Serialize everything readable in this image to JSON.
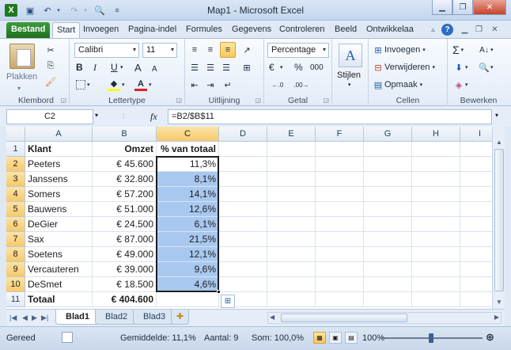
{
  "window": {
    "title": "Map1 - Microsoft Excel"
  },
  "ribbon_tabs": [
    "Bestand",
    "Start",
    "Invoegen",
    "Pagina-indel",
    "Formules",
    "Gegevens",
    "Controleren",
    "Beeld",
    "Ontwikkelaa"
  ],
  "ribbon": {
    "clipboard": {
      "paste_label": "Plakken",
      "group_label": "Klembord"
    },
    "font": {
      "font_name": "Calibri",
      "font_size": "11",
      "bold": "B",
      "italic": "I",
      "underline": "U",
      "grow": "A",
      "shrink": "A",
      "group_label": "Lettertype"
    },
    "alignment": {
      "group_label": "Uitlijning"
    },
    "number": {
      "format": "Percentage",
      "currency_symbol": "€",
      "percent": "%",
      "thousands": "000",
      "group_label": "Getal"
    },
    "styles": {
      "label": "Stijlen",
      "icon_letter": "A"
    },
    "cells": {
      "insert": "Invoegen",
      "delete": "Verwijderen",
      "format": "Opmaak",
      "group_label": "Cellen"
    },
    "editing": {
      "sum_symbol": "Σ",
      "group_label": "Bewerken"
    }
  },
  "formula_bar": {
    "name_box": "C2",
    "fx": "fx",
    "formula": "=B2/$B$11"
  },
  "sheet": {
    "columns": [
      "A",
      "B",
      "C",
      "D",
      "E",
      "F",
      "G",
      "H",
      "I"
    ],
    "rows": [
      {
        "num": "1",
        "a": "Klant",
        "b": "Omzet",
        "c": "% van totaal"
      },
      {
        "num": "2",
        "a": "Peeters",
        "b": "€ 45.600",
        "c": "11,3%"
      },
      {
        "num": "3",
        "a": "Janssens",
        "b": "€ 32.800",
        "c": "8,1%"
      },
      {
        "num": "4",
        "a": "Somers",
        "b": "€ 57.200",
        "c": "14,1%"
      },
      {
        "num": "5",
        "a": "Bauwens",
        "b": "€ 51.000",
        "c": "12,6%"
      },
      {
        "num": "6",
        "a": "DeGier",
        "b": "€ 24.500",
        "c": "6,1%"
      },
      {
        "num": "7",
        "a": "Sax",
        "b": "€ 87.000",
        "c": "21,5%"
      },
      {
        "num": "8",
        "a": "Soetens",
        "b": "€ 49.000",
        "c": "12,1%"
      },
      {
        "num": "9",
        "a": "Vercauteren",
        "b": "€ 39.000",
        "c": "9,6%"
      },
      {
        "num": "10",
        "a": "DeSmet",
        "b": "€ 18.500",
        "c": "4,6%"
      },
      {
        "num": "11",
        "a": "Totaal",
        "b": "€ 404.600",
        "c": ""
      }
    ]
  },
  "sheet_tabs": [
    "Blad1",
    "Blad2",
    "Blad3"
  ],
  "status": {
    "ready": "Gereed",
    "average": "Gemiddelde: 11,1%",
    "count": "Aantal: 9",
    "sum": "Som: 100,0%",
    "zoom": "100%"
  },
  "colors": {
    "selection_fill": "#a9c8f0",
    "file_tab": "#2e8b2e",
    "accent": "#f8c85a"
  }
}
